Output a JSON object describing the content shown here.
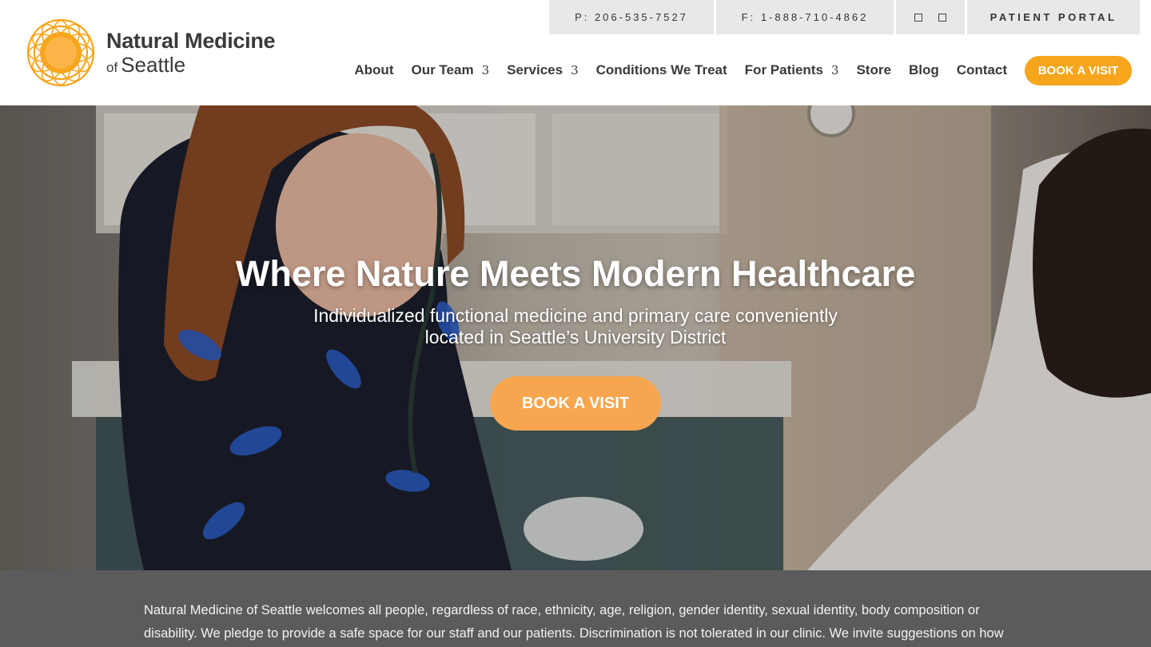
{
  "topbar": {
    "phone": "P: 206-535-7527",
    "fax": "F: 1-888-710-4862",
    "social_icons": [
      "facebook-icon",
      "instagram-icon"
    ],
    "portal": "PATIENT PORTAL"
  },
  "logo": {
    "line1": "Natural Medicine",
    "line2_of": "of",
    "line2": "Seattle",
    "color": "#f7a51c"
  },
  "nav": {
    "items": [
      {
        "label": "About",
        "has_dropdown": false
      },
      {
        "label": "Our Team",
        "has_dropdown": true
      },
      {
        "label": "Services",
        "has_dropdown": true
      },
      {
        "label": "Conditions We Treat",
        "has_dropdown": false
      },
      {
        "label": "For Patients",
        "has_dropdown": true
      },
      {
        "label": "Store",
        "has_dropdown": false
      },
      {
        "label": "Blog",
        "has_dropdown": false
      },
      {
        "label": "Contact",
        "has_dropdown": false
      }
    ],
    "dropdown_glyph": "3",
    "cta": "BOOK A VISIT"
  },
  "hero": {
    "title": "Where Nature Meets Modern Healthcare",
    "subtitle": "Individualized functional medicine and primary care conveniently located in Seattle’s University District",
    "cta": "BOOK A VISIT",
    "accent": "#f7a54e"
  },
  "notice": {
    "text": "Natural Medicine of Seattle welcomes all people, regardless of race, ethnicity, age, religion, gender identity, sexual identity, body composition or disability. We pledge to provide a safe space for our staff and our patients. Discrimination is not tolerated in our clinic. We invite suggestions on how we"
  }
}
